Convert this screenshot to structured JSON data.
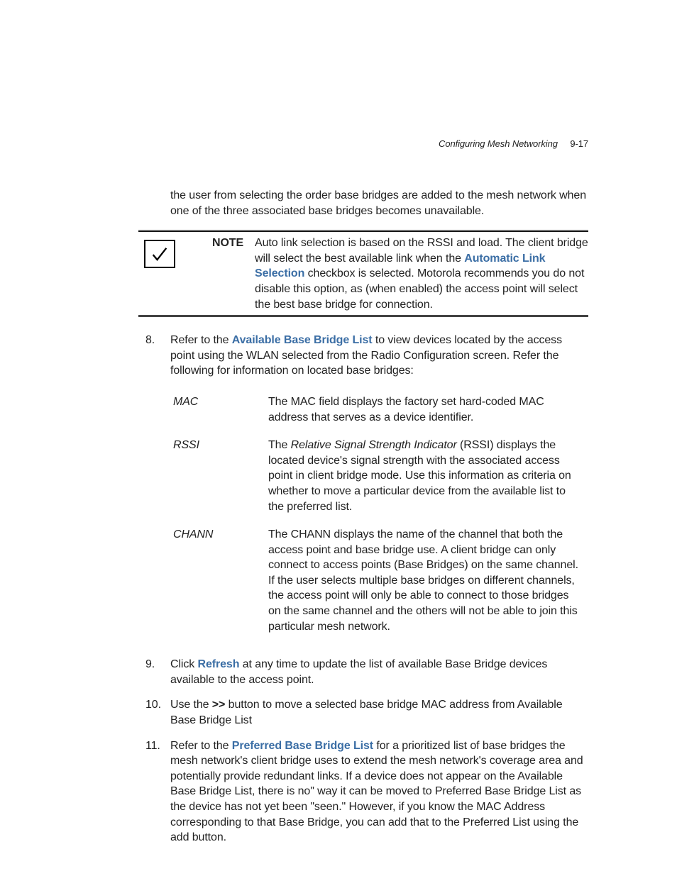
{
  "header": {
    "section_title": "Configuring Mesh Networking",
    "page_number": "9-17"
  },
  "intro_paragraph": "the user from selecting the order base bridges are added to the mesh network when one of the three associated base bridges becomes unavailable.",
  "note": {
    "label": "NOTE",
    "text_before": "Auto link selection is based on the RSSI and load. The client bridge will select the best available link when the ",
    "link_text": "Automatic Link Selection",
    "text_after": " checkbox is selected. Motorola recommends you do not disable this option, as (when enabled) the access point will select the best base bridge for connection."
  },
  "steps": [
    {
      "num": "8.",
      "prefix": "Refer to the ",
      "link": "Available Base Bridge List",
      "suffix": " to view devices located by the access point using the WLAN selected from the Radio Configuration screen. Refer the following for information on located base bridges:",
      "definitions": [
        {
          "term": "MAC",
          "desc": "The MAC field displays the factory set hard-coded MAC address that serves as a device identifier."
        },
        {
          "term": "RSSI",
          "desc_prefix": "The ",
          "desc_italic": "Relative Signal Strength Indicator",
          "desc_suffix": " (RSSI) displays the located device's signal strength with the associated access point in client bridge mode. Use this information as criteria on whether to move a particular device from the available list to the preferred list."
        },
        {
          "term": "CHANN",
          "desc": "The CHANN displays the name of the channel that both the access point and base bridge use. A client bridge can only connect to access points (Base Bridges) on the same channel. If the user selects multiple base bridges on different channels, the access point will only be able to connect to those bridges on the same channel and the others will not be able to join this particular mesh network."
        }
      ]
    },
    {
      "num": "9.",
      "prefix": "Click ",
      "link": "Refresh",
      "suffix": " at any time to update the list of available Base Bridge devices available to the access point."
    },
    {
      "num": "10.",
      "prefix": "Use the ",
      "link": ">>",
      "suffix": " button to move a selected base bridge MAC address from Available Base Bridge List"
    },
    {
      "num": "11.",
      "prefix": "Refer to the ",
      "link": "Preferred Base Bridge List",
      "suffix": " for a prioritized list of base bridges the mesh network's client bridge uses to extend the mesh network's coverage area and potentially provide redundant links. If a device does not appear on the Available Base Bridge List, there is no\" way it can be moved to Preferred Base Bridge List as the device has not yet been \"seen.\" However, if you know the MAC Address corresponding to that Base Bridge, you can add that to the Preferred List using the add button."
    }
  ]
}
